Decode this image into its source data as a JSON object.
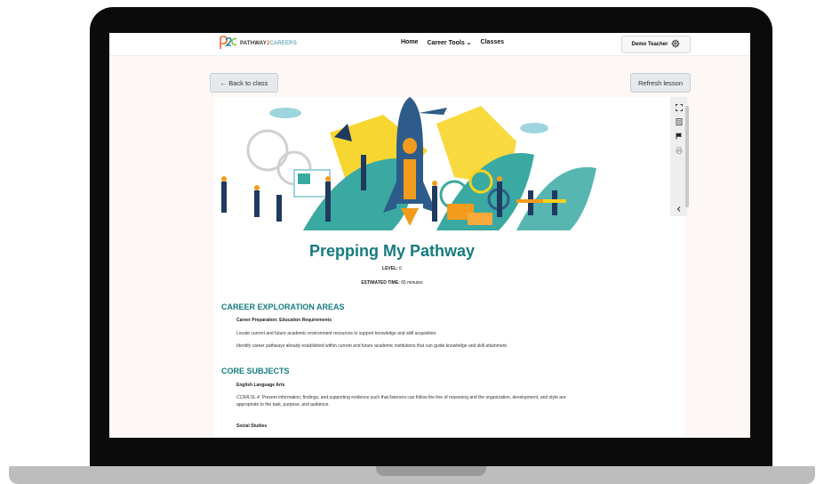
{
  "nav": {
    "logo_text": "PATHWAY",
    "logo_two": "2",
    "logo_careers": "CAREERS",
    "links": [
      "Home",
      "Career Tools ⌄",
      "Classes"
    ],
    "user_label": "Demo Teacher"
  },
  "toolbar": {
    "back_label": "←  Back to class",
    "refresh_label": "Refresh lesson"
  },
  "lesson": {
    "title": "Prepping My Pathway",
    "level_label": "LEVEL:",
    "level_value": " 6",
    "time_label": "ESTIMATED TIME:",
    "time_value": " 65 minutes",
    "section1_heading": "CAREER EXPLORATION AREAS",
    "section1_sub": "Career Preparation: Education Requirements",
    "section1_p1": "Locate current and future academic environment resources to support knowledge and skill acquisition.",
    "section1_p2": "Identify career pathways already established within current and future academic institutions that can guide knowledge and skill attainment.",
    "section2_heading": "CORE SUBJECTS",
    "section2_sub1": "English Language Arts",
    "section2_code": "CCRA.SL.4:",
    "section2_p1": " Present information, findings, and supporting evidence such that listeners can follow the line of reasoning and the organization, development, and style are appropriate to the task, purpose, and audience.",
    "section2_sub2": "Social Studies"
  },
  "side_icons": [
    "fullscreen-icon",
    "document-icon",
    "flag-icon",
    "print-icon",
    "chevron-left-icon"
  ],
  "colors": {
    "accent": "#167b80",
    "orange": "#e8692b",
    "rocket": "#2e5c8a"
  }
}
